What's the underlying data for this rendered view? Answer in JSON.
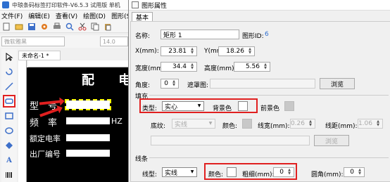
{
  "left_app": {
    "title": "中琅条码标签打印软件-V6.5.3 试用版 单机",
    "menus": [
      "文件(F)",
      "编辑(E)",
      "查看(V)",
      "绘图(D)",
      "图形(S)"
    ],
    "font_name": "微软雅黑",
    "font_size": "14.0",
    "doc_tab": "未命名-1 *",
    "canvas": {
      "title": "配 电",
      "row1_label": "型　号",
      "row2_label": "频　率",
      "row2_unit": "HZ",
      "row3_label": "额定电率",
      "row4_label": "出厂编号"
    }
  },
  "dialog": {
    "title": "图形属性",
    "tab": "基本",
    "name_label": "名称:",
    "name_value": "矩形 1",
    "shape_id_label": "图形ID:",
    "shape_id_value": "6",
    "x_label": "X(mm):",
    "x_value": "23.81",
    "y_label": "Y(mm):",
    "y_value": "18.26",
    "width_label": "宽度(mm):",
    "width_value": "34.4",
    "height_label": "高度(mm):",
    "height_value": "5.56",
    "angle_label": "角度:",
    "angle_value": "0",
    "mask_label": "遮罩图:",
    "browse_label": "浏览",
    "fill": {
      "section": "填充",
      "type_label": "类型:",
      "type_value": "实心",
      "bg_color_label": "背景色",
      "fg_color_label": "前景色",
      "bottom_line_label": "底纹:",
      "bottom_line_value": "实线",
      "color_label": "颜色:",
      "line_width_label": "线宽(mm):",
      "line_width_value": "0.26",
      "line_gap_label": "线距(mm):",
      "line_gap_value": "1.06",
      "browse2_label": "浏览"
    },
    "line": {
      "section": "线条",
      "type_label": "线型:",
      "type_value": "实线",
      "color_label": "颜色:",
      "thickness_label": "粗细(mm):",
      "thickness_value": "0",
      "radius_label": "圆角(mm):",
      "radius_value": "0"
    }
  },
  "colors": {
    "highlight": "#e02020",
    "accent_blue": "#2e6fcf"
  }
}
